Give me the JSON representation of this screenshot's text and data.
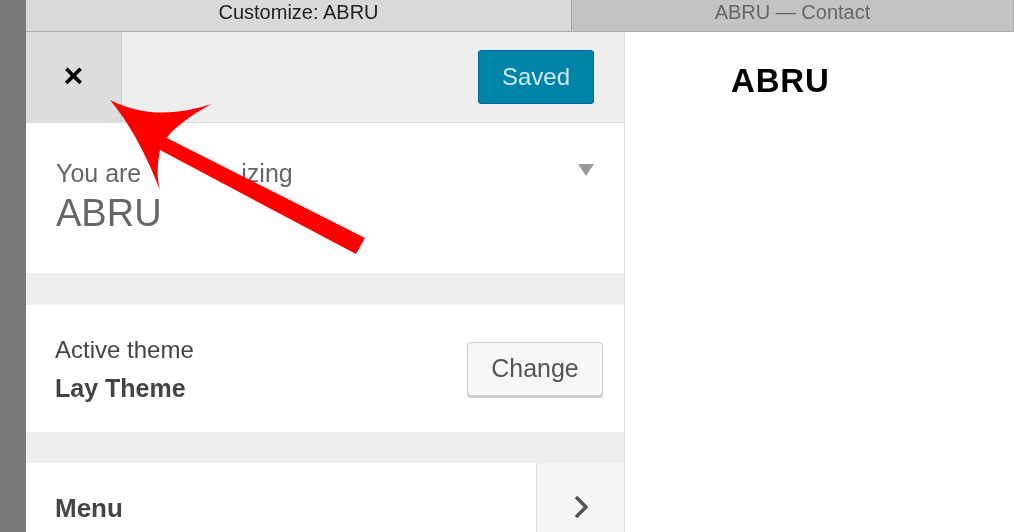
{
  "tabs": [
    {
      "label": "Customize: ABRU",
      "selected": true
    },
    {
      "label": "ABRU — Contact",
      "selected": false
    }
  ],
  "header": {
    "close": "×",
    "save_button": "Saved"
  },
  "info": {
    "caption_parts": [
      "You are",
      "izing"
    ],
    "site_title": "ABRU",
    "expanded": false
  },
  "theme": {
    "caption": "Active theme",
    "name": "Lay Theme",
    "button": "Change"
  },
  "sections": [
    {
      "title": "Menu"
    }
  ],
  "preview": {
    "site_title": "ABRU"
  }
}
